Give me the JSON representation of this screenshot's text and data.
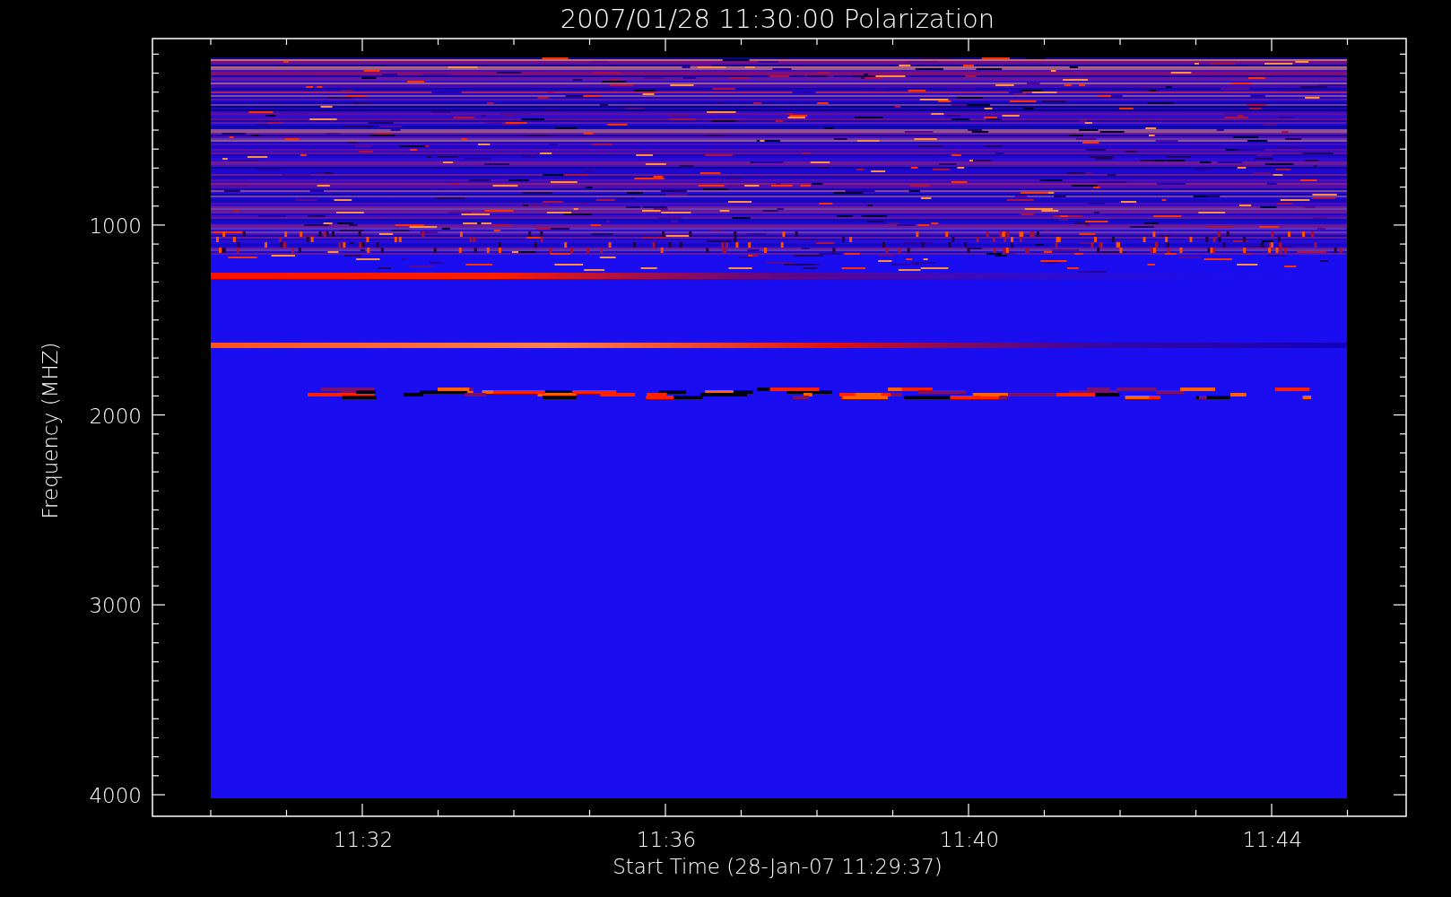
{
  "title": "2007/01/28 11:30:00 Polarization",
  "y_axis": {
    "label": "Frequency (MHZ)",
    "ticks": [
      "1000",
      "2000",
      "3000",
      "4000"
    ]
  },
  "x_axis": {
    "label": "Start Time (28-Jan-07 11:29:37)",
    "ticks": [
      "11:32",
      "11:36",
      "11:40",
      "11:44"
    ]
  }
}
